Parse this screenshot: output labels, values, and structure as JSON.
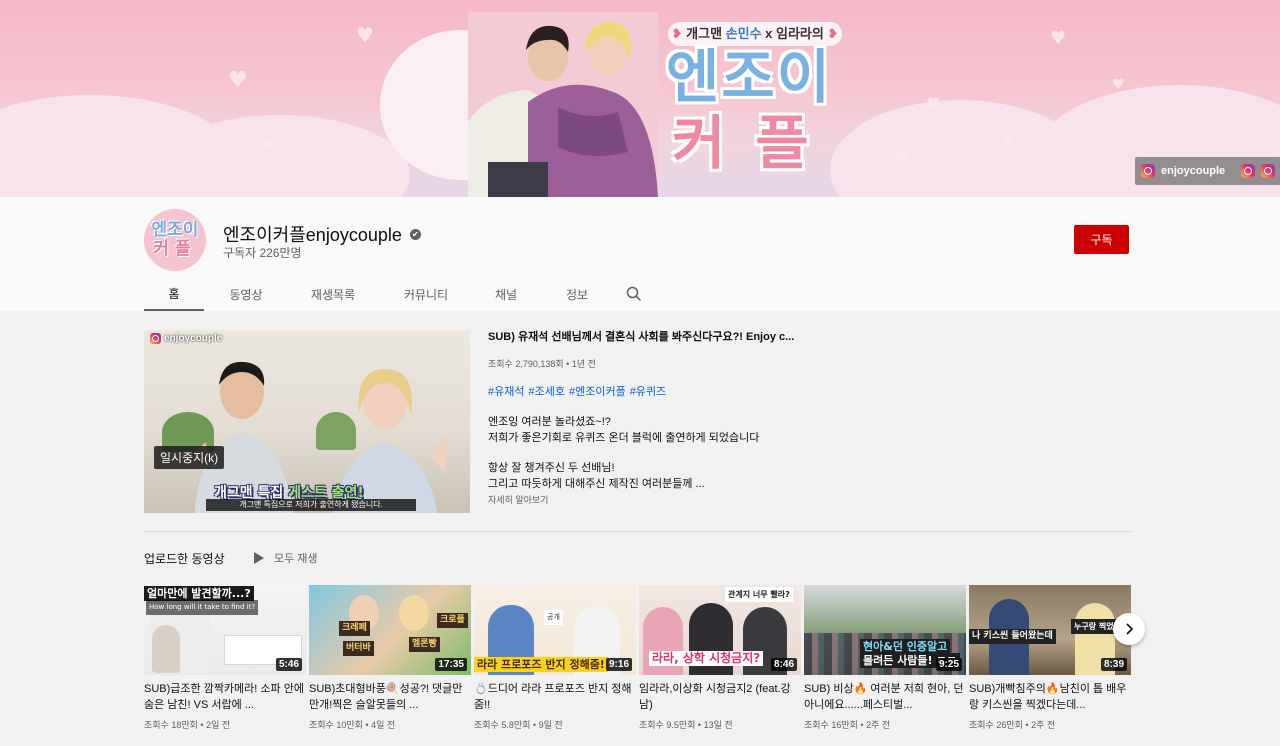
{
  "banner": {
    "tagline_pre": "개그맨 ",
    "tagline_name": "손민수",
    "tagline_post": " x 임라라의",
    "logo_line1": "엔조이",
    "logo_line2": "커플",
    "link_label": "enjoycouple",
    "link_icon": "instagram-icon"
  },
  "channel": {
    "avatar_line1": "엔조이",
    "avatar_line2": "커플",
    "name": "엔조이커플enjoycouple",
    "verified_mark": "✔",
    "subscribers": "구독자 226만명",
    "subscribe_label": "구독"
  },
  "tabs": [
    {
      "label": "홈",
      "active": true
    },
    {
      "label": "동영상",
      "active": false
    },
    {
      "label": "재생목록",
      "active": false
    },
    {
      "label": "커뮤니티",
      "active": false
    },
    {
      "label": "채널",
      "active": false
    },
    {
      "label": "정보",
      "active": false
    }
  ],
  "featured": {
    "channel_tag": "enjoycouple",
    "pause_tooltip": "일시중지(k)",
    "caption_part1": "개그맨 특집",
    "caption_part2": " 게스트 출연!",
    "subtitle": "개그맨 특집으로 저희가 출연하게 됐습니다.",
    "title": "SUB) 유재석 선배님께서 결혼식 사회를 봐주신다구요?! Enjoy c...",
    "meta": "조회수 2,790,138회 • 1년 전",
    "hashtags": [
      "#유재석",
      "#조세호",
      "#엔조이커플",
      "#유퀴즈"
    ],
    "desc_line1": "엔조잉 여러분 놀라셨죠~!?",
    "desc_line2": "저희가 좋은기회로 유퀴즈 온더 블럭에 출연하게 되었습니다",
    "desc_line3": "항상 잘 챙겨주신 두 선배님!",
    "desc_line4": "그리고 따듯하게 대해주신 제작진 여러분들께 ...",
    "more_label": "자세히 알아보기"
  },
  "uploads": {
    "section_title": "업로드한 동영상",
    "play_all": "모두 재생",
    "videos": [
      {
        "caption": "얼마만에 발견할까...?",
        "caption2": "How long will it take to find it?",
        "duration": "5:46",
        "title": "SUB)급조한 깜짝카메라! 소파 안에 숨은 남친! VS 서랍에 ...",
        "meta": "조회수 18만회 • 2일 전"
      },
      {
        "caption": "크레페",
        "caption2": "크로플",
        "caption3": "멜론빵",
        "caption4": "버터바",
        "duration": "17:35",
        "title": "SUB)초대형바풍🍭성공?! 댓글만 만개!찍은 슬알못들의 ...",
        "meta": "조회수 10만회 • 4일 전"
      },
      {
        "caption": "라라 프로포즈 반지 정해줌!",
        "caption2": "공개",
        "duration": "9:16",
        "title": "💍드디어 라라 프로포즈 반지 정해줌!!",
        "meta": "조회수 5.8만회 • 9일 전"
      },
      {
        "caption": "라라, 상학 시청금지?",
        "caption2": "관계지 너무 빨라?",
        "duration": "8:46",
        "title": "임라라,이상화 시청금지2 (feat.강남)",
        "meta": "조회수 9.5만회 • 13일 전"
      },
      {
        "caption": "현아&던 인증알고",
        "caption2": "몰려든 사람들! ㄷㄷ",
        "duration": "9:25",
        "title": "SUB) 비상🔥 여러분 저희 현아, 던 아니에요......페스티벌...",
        "meta": "조회수 16만회 • 2주 전"
      },
      {
        "caption": "나 키스씬 들어왔는데",
        "caption2": "누구랑 찍었다고?",
        "duration": "8:39",
        "title": "SUB)개빡침주의🔥남친이 톱 배우랑 키스씬을 찍겠다는데...",
        "meta": "조회수 26만회 • 2주 전"
      }
    ]
  },
  "colors": {
    "subscribe": "#cc0000",
    "link": "#065fd4",
    "banner_pink": "#f3b8c6"
  }
}
